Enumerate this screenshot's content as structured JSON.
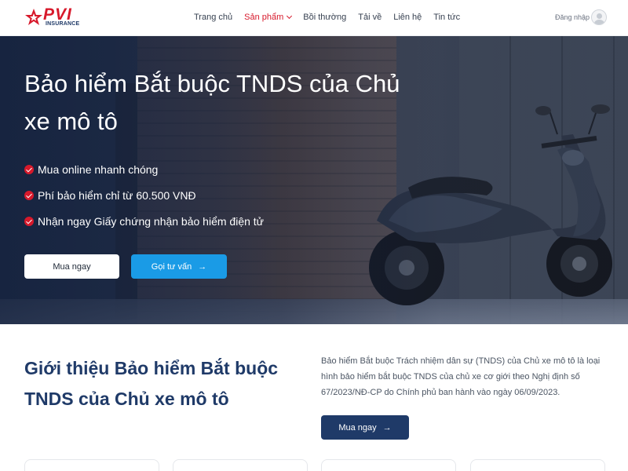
{
  "brand": {
    "logo_text": "PVI",
    "logo_subtext": "INSURANCE",
    "primary_color": "#d7192b",
    "navy_color": "#1f3a68",
    "accent_blue": "#1a9be6"
  },
  "nav": {
    "items": [
      {
        "label": "Trang chủ",
        "active": false
      },
      {
        "label": "Sản phẩm",
        "active": true,
        "has_dropdown": true
      },
      {
        "label": "Bồi thường",
        "active": false
      },
      {
        "label": "Tải về",
        "active": false
      },
      {
        "label": "Liên hệ",
        "active": false
      },
      {
        "label": "Tin tức",
        "active": false
      }
    ],
    "login_label": "Đăng nhập"
  },
  "hero": {
    "title": "Bảo hiểm Bắt buộc TNDS của Chủ xe mô tô",
    "features": [
      "Mua online nhanh chóng",
      "Phí bảo hiểm chỉ từ 60.500 VNĐ",
      "Nhận ngay Giấy chứng nhận bảo hiểm điện tử"
    ],
    "buy_label": "Mua ngay",
    "consult_label": "Gọi tư vấn",
    "consult_icon": "arrow-right-icon"
  },
  "intro": {
    "title": "Giới thiệu Bảo hiểm Bắt buộc TNDS của Chủ xe mô tô",
    "description": "Bảo hiểm Bắt buộc Trách nhiệm dân sự (TNDS) của Chủ xe mô tô là loại hình bảo hiểm bắt buộc TNDS của chủ xe cơ giới theo Nghị định số 67/2023/NĐ-CP do Chính phủ ban hành vào ngày 06/09/2023.",
    "buy_label": "Mua ngay",
    "buy_icon": "arrow-right-icon"
  }
}
